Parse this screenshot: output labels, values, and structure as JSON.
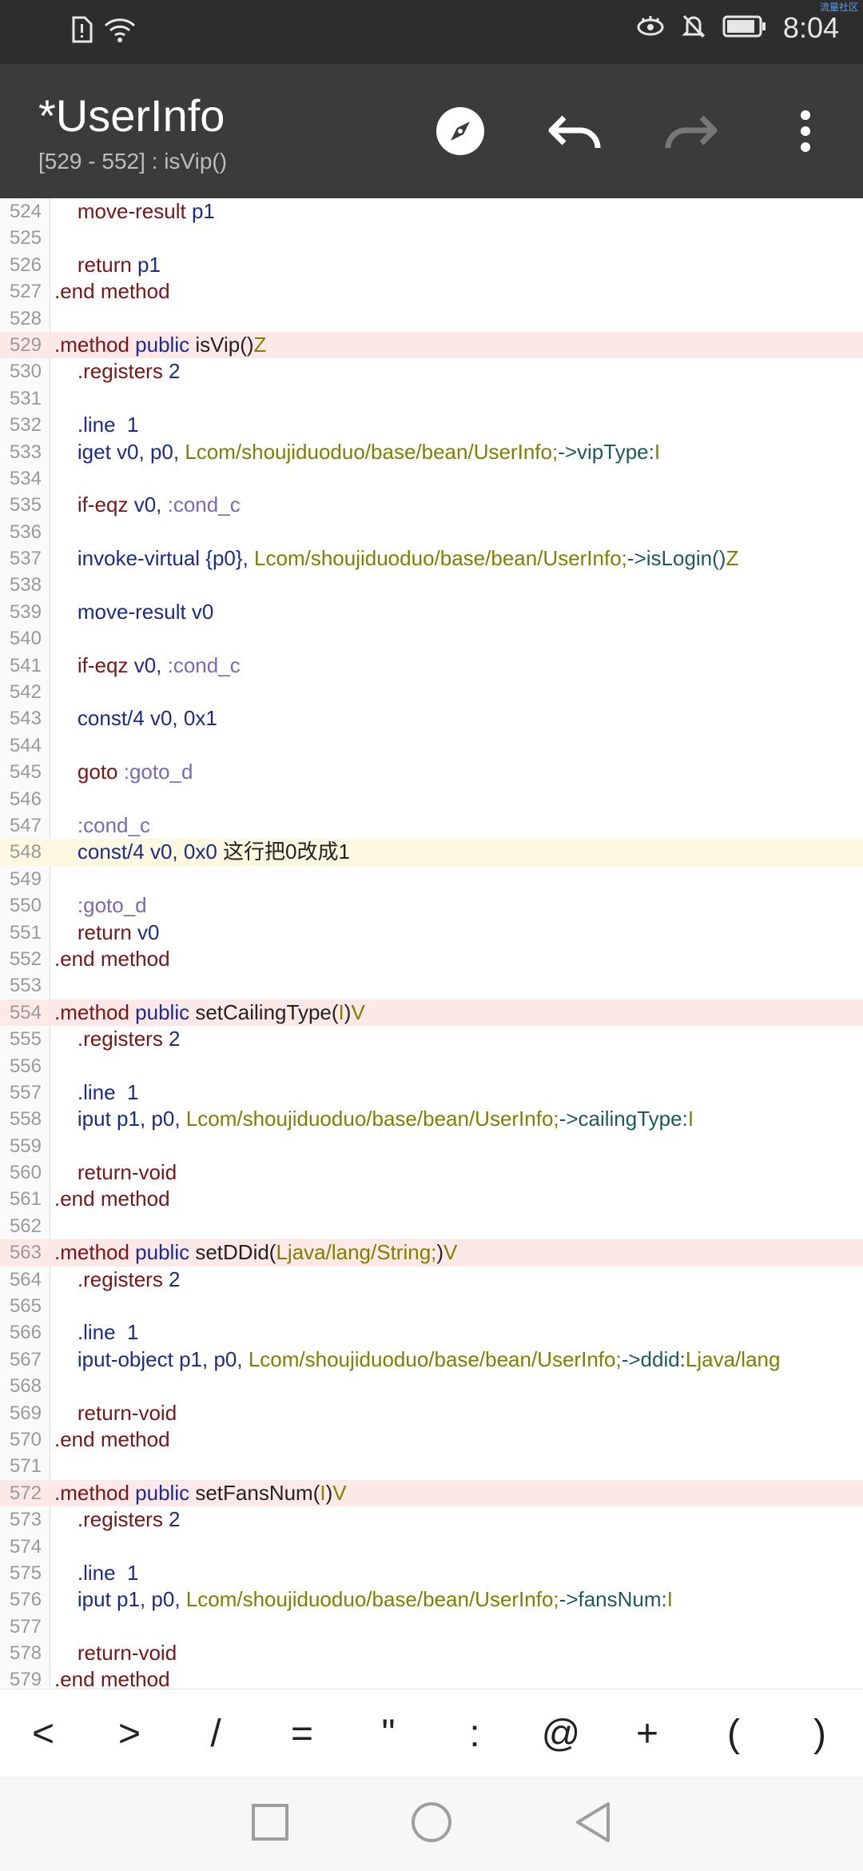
{
  "status_bar": {
    "time": "8:04",
    "watermark": "流量社区",
    "icons": [
      "sim-alert-icon",
      "wifi-icon",
      "eye-comfort-icon",
      "bell-off-icon",
      "battery-icon"
    ]
  },
  "app_bar": {
    "title": "*UserInfo",
    "subtitle": "[529 - 552] : isVip()",
    "icons": [
      "compass-icon",
      "undo-icon",
      "redo-icon",
      "more-vert-icon"
    ]
  },
  "lines": [
    {
      "n": "524",
      "hl": "",
      "t": [
        {
          "c": "kw",
          "s": "    move-result "
        },
        {
          "c": "reg",
          "s": "p1"
        }
      ]
    },
    {
      "n": "525",
      "hl": "",
      "t": []
    },
    {
      "n": "526",
      "hl": "",
      "t": [
        {
          "c": "kw",
          "s": "    return "
        },
        {
          "c": "reg",
          "s": "p1"
        }
      ]
    },
    {
      "n": "527",
      "hl": "",
      "t": [
        {
          "c": "kw",
          "s": ".end method"
        }
      ]
    },
    {
      "n": "528",
      "hl": "",
      "t": []
    },
    {
      "n": "529",
      "hl": "pink",
      "t": [
        {
          "c": "kw",
          "s": ".method "
        },
        {
          "c": "reg",
          "s": "public "
        },
        {
          "c": "txt",
          "s": "isVip()"
        },
        {
          "c": "cls",
          "s": "Z"
        }
      ]
    },
    {
      "n": "530",
      "hl": "",
      "t": [
        {
          "c": "kw",
          "s": "    .registers "
        },
        {
          "c": "reg",
          "s": "2"
        }
      ]
    },
    {
      "n": "531",
      "hl": "",
      "t": []
    },
    {
      "n": "532",
      "hl": "",
      "t": [
        {
          "c": "reg",
          "s": "    .line  1"
        }
      ]
    },
    {
      "n": "533",
      "hl": "",
      "t": [
        {
          "c": "reg",
          "s": "    iget v0, p0, "
        },
        {
          "c": "cls",
          "s": "Lcom/shoujiduoduo/base/bean/UserInfo;"
        },
        {
          "c": "fld",
          "s": "->vipType:"
        },
        {
          "c": "cls",
          "s": "I"
        }
      ]
    },
    {
      "n": "534",
      "hl": "",
      "t": []
    },
    {
      "n": "535",
      "hl": "",
      "t": [
        {
          "c": "kw",
          "s": "    if-eqz "
        },
        {
          "c": "reg",
          "s": "v0, "
        },
        {
          "c": "lbl",
          "s": ":cond_c"
        }
      ]
    },
    {
      "n": "536",
      "hl": "",
      "t": []
    },
    {
      "n": "537",
      "hl": "",
      "t": [
        {
          "c": "reg",
          "s": "    invoke-virtual {p0}, "
        },
        {
          "c": "cls",
          "s": "Lcom/shoujiduoduo/base/bean/UserInfo;"
        },
        {
          "c": "fld",
          "s": "->isLogin()"
        },
        {
          "c": "cls",
          "s": "Z"
        }
      ]
    },
    {
      "n": "538",
      "hl": "",
      "t": []
    },
    {
      "n": "539",
      "hl": "",
      "t": [
        {
          "c": "reg",
          "s": "    move-result v0"
        }
      ]
    },
    {
      "n": "540",
      "hl": "",
      "t": []
    },
    {
      "n": "541",
      "hl": "",
      "t": [
        {
          "c": "kw",
          "s": "    if-eqz "
        },
        {
          "c": "reg",
          "s": "v0, "
        },
        {
          "c": "lbl",
          "s": ":cond_c"
        }
      ]
    },
    {
      "n": "542",
      "hl": "",
      "t": []
    },
    {
      "n": "543",
      "hl": "",
      "t": [
        {
          "c": "reg",
          "s": "    const/4 v0, 0x1"
        }
      ]
    },
    {
      "n": "544",
      "hl": "",
      "t": []
    },
    {
      "n": "545",
      "hl": "",
      "t": [
        {
          "c": "kw",
          "s": "    goto "
        },
        {
          "c": "lbl",
          "s": ":goto_d"
        }
      ]
    },
    {
      "n": "546",
      "hl": "",
      "t": []
    },
    {
      "n": "547",
      "hl": "",
      "t": [
        {
          "c": "lbl",
          "s": "    :cond_c"
        }
      ]
    },
    {
      "n": "548",
      "hl": "yellow",
      "t": [
        {
          "c": "reg",
          "s": "    const/4 v0, 0x0 "
        },
        {
          "c": "txt",
          "s": "这行把0改成1"
        }
      ]
    },
    {
      "n": "549",
      "hl": "",
      "t": []
    },
    {
      "n": "550",
      "hl": "",
      "t": [
        {
          "c": "lbl",
          "s": "    :goto_d"
        }
      ]
    },
    {
      "n": "551",
      "hl": "",
      "t": [
        {
          "c": "kw",
          "s": "    return "
        },
        {
          "c": "reg",
          "s": "v0"
        }
      ]
    },
    {
      "n": "552",
      "hl": "",
      "t": [
        {
          "c": "kw",
          "s": ".end method"
        }
      ]
    },
    {
      "n": "553",
      "hl": "",
      "t": []
    },
    {
      "n": "554",
      "hl": "pink",
      "t": [
        {
          "c": "kw",
          "s": ".method "
        },
        {
          "c": "reg",
          "s": "public "
        },
        {
          "c": "txt",
          "s": "setCailingType("
        },
        {
          "c": "cls",
          "s": "I"
        },
        {
          "c": "txt",
          "s": ")"
        },
        {
          "c": "cls",
          "s": "V"
        }
      ]
    },
    {
      "n": "555",
      "hl": "",
      "t": [
        {
          "c": "kw",
          "s": "    .registers "
        },
        {
          "c": "reg",
          "s": "2"
        }
      ]
    },
    {
      "n": "556",
      "hl": "",
      "t": []
    },
    {
      "n": "557",
      "hl": "",
      "t": [
        {
          "c": "reg",
          "s": "    .line  1"
        }
      ]
    },
    {
      "n": "558",
      "hl": "",
      "t": [
        {
          "c": "reg",
          "s": "    iput p1, p0, "
        },
        {
          "c": "cls",
          "s": "Lcom/shoujiduoduo/base/bean/UserInfo;"
        },
        {
          "c": "fld",
          "s": "->cailingType:"
        },
        {
          "c": "cls",
          "s": "I"
        }
      ]
    },
    {
      "n": "559",
      "hl": "",
      "t": []
    },
    {
      "n": "560",
      "hl": "",
      "t": [
        {
          "c": "kw",
          "s": "    return-void"
        }
      ]
    },
    {
      "n": "561",
      "hl": "",
      "t": [
        {
          "c": "kw",
          "s": ".end method"
        }
      ]
    },
    {
      "n": "562",
      "hl": "",
      "t": []
    },
    {
      "n": "563",
      "hl": "pink",
      "t": [
        {
          "c": "kw",
          "s": ".method "
        },
        {
          "c": "reg",
          "s": "public "
        },
        {
          "c": "txt",
          "s": "setDDid("
        },
        {
          "c": "cls",
          "s": "Ljava/lang/String;"
        },
        {
          "c": "txt",
          "s": ")"
        },
        {
          "c": "cls",
          "s": "V"
        }
      ]
    },
    {
      "n": "564",
      "hl": "",
      "t": [
        {
          "c": "kw",
          "s": "    .registers "
        },
        {
          "c": "reg",
          "s": "2"
        }
      ]
    },
    {
      "n": "565",
      "hl": "",
      "t": []
    },
    {
      "n": "566",
      "hl": "",
      "t": [
        {
          "c": "reg",
          "s": "    .line  1"
        }
      ]
    },
    {
      "n": "567",
      "hl": "",
      "t": [
        {
          "c": "reg",
          "s": "    iput-object p1, p0, "
        },
        {
          "c": "cls",
          "s": "Lcom/shoujiduoduo/base/bean/UserInfo;"
        },
        {
          "c": "fld",
          "s": "->ddid:"
        },
        {
          "c": "cls",
          "s": "Ljava/lang"
        }
      ]
    },
    {
      "n": "568",
      "hl": "",
      "t": []
    },
    {
      "n": "569",
      "hl": "",
      "t": [
        {
          "c": "kw",
          "s": "    return-void"
        }
      ]
    },
    {
      "n": "570",
      "hl": "",
      "t": [
        {
          "c": "kw",
          "s": ".end method"
        }
      ]
    },
    {
      "n": "571",
      "hl": "",
      "t": []
    },
    {
      "n": "572",
      "hl": "pink",
      "t": [
        {
          "c": "kw",
          "s": ".method "
        },
        {
          "c": "reg",
          "s": "public "
        },
        {
          "c": "txt",
          "s": "setFansNum("
        },
        {
          "c": "cls",
          "s": "I"
        },
        {
          "c": "txt",
          "s": ")"
        },
        {
          "c": "cls",
          "s": "V"
        }
      ]
    },
    {
      "n": "573",
      "hl": "",
      "t": [
        {
          "c": "kw",
          "s": "    .registers "
        },
        {
          "c": "reg",
          "s": "2"
        }
      ]
    },
    {
      "n": "574",
      "hl": "",
      "t": []
    },
    {
      "n": "575",
      "hl": "",
      "t": [
        {
          "c": "reg",
          "s": "    .line  1"
        }
      ]
    },
    {
      "n": "576",
      "hl": "",
      "t": [
        {
          "c": "reg",
          "s": "    iput p1, p0, "
        },
        {
          "c": "cls",
          "s": "Lcom/shoujiduoduo/base/bean/UserInfo;"
        },
        {
          "c": "fld",
          "s": "->fansNum:"
        },
        {
          "c": "cls",
          "s": "I"
        }
      ]
    },
    {
      "n": "577",
      "hl": "",
      "t": []
    },
    {
      "n": "578",
      "hl": "",
      "t": [
        {
          "c": "kw",
          "s": "    return-void"
        }
      ]
    },
    {
      "n": "579",
      "hl": "",
      "t": [
        {
          "c": "kw",
          "s": ".end method"
        }
      ]
    }
  ],
  "symbol_bar": [
    "<",
    ">",
    "/",
    "=",
    "\"",
    ":",
    "@",
    "+",
    "(",
    ")"
  ],
  "nav_bar": {
    "icons": [
      "recents-square-icon",
      "home-circle-icon",
      "back-triangle-icon"
    ]
  },
  "colors": {
    "status_bar_bg": "#2d2d2d",
    "app_bar_bg": "#3b3b3b",
    "method_highlight": "#fde8e8",
    "current_line_highlight": "#fff8e1"
  }
}
